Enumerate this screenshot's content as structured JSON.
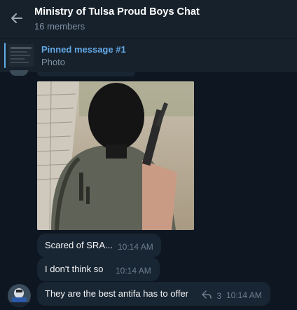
{
  "chat": {
    "title": "Ministry of Tulsa Proud Boys Chat",
    "members": "16 members"
  },
  "pinned": {
    "title": "Pinned message #1",
    "subtitle": "Photo"
  },
  "messages": [
    {
      "text": "Scared of SRA...",
      "time": "10:14 AM"
    },
    {
      "text": "I don't think so",
      "time": "10:14 AM"
    },
    {
      "text": "They are the best antifa has to offer",
      "time": "10:14 AM",
      "replies": "3"
    }
  ],
  "icons": {
    "back": "arrow-left-icon",
    "reply": "reply-arrow-icon"
  },
  "colors": {
    "background": "#0e1621",
    "header": "#17212b",
    "bubble": "#182533",
    "accent": "#62a8e5",
    "muted": "#7f91a4"
  }
}
